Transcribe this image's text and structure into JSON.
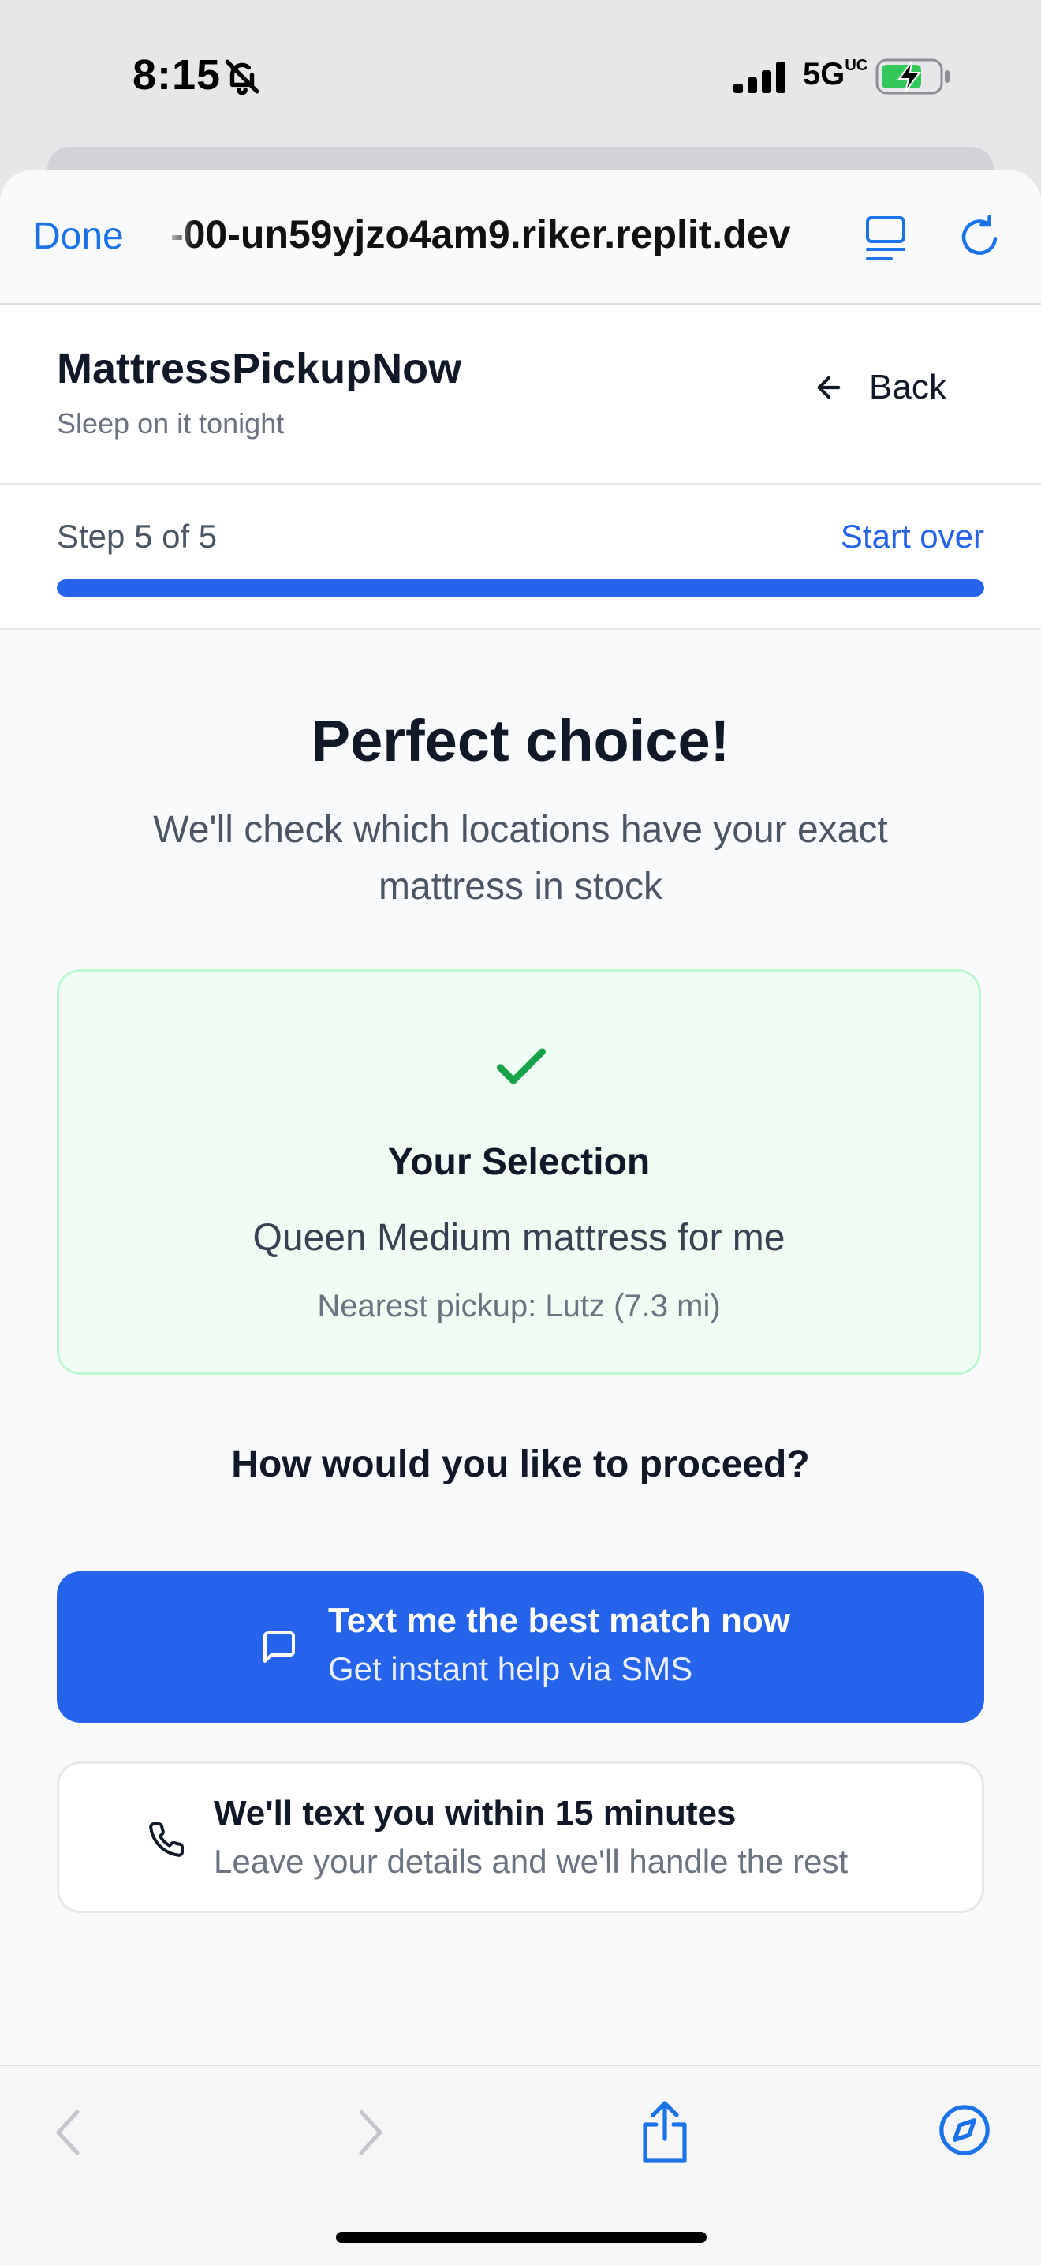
{
  "status_bar": {
    "time": "8:15",
    "network": "5G",
    "network_sup": "UC",
    "icons": [
      "bell-slash-icon",
      "signal-icon",
      "battery-charging-icon"
    ]
  },
  "browser": {
    "done_label": "Done",
    "url": "-00-un59yjzo4am9.riker.replit.dev",
    "icons": [
      "reader-view-icon",
      "reload-icon"
    ]
  },
  "header": {
    "brand": "MattressPickupNow",
    "tagline": "Sleep on it tonight",
    "back_label": "Back"
  },
  "progress": {
    "step_text": "Step 5 of 5",
    "start_over_label": "Start over",
    "fraction": 1.0
  },
  "main": {
    "title": "Perfect choice!",
    "subtitle": "We'll check which locations have your exact mattress in stock",
    "selection_card": {
      "title": "Your Selection",
      "summary": "Queen Medium mattress for me",
      "pickup": "Nearest pickup: Lutz (7.3 mi)"
    },
    "question": "How would you like to proceed?",
    "primary_option": {
      "title": "Text me the best match now",
      "subtitle": "Get instant help via SMS",
      "icon": "message-square-icon"
    },
    "secondary_option": {
      "title": "We'll text you within 15 minutes",
      "subtitle": "Leave your details and we'll handle the rest",
      "icon": "phone-icon"
    }
  },
  "toolbar": {
    "icons": [
      "back-arrow-icon",
      "forward-arrow-icon",
      "share-icon",
      "compass-icon"
    ]
  },
  "colors": {
    "accent": "#2563eb",
    "ios_blue": "#1a73e8",
    "success": "#16a34a",
    "card_bg": "#effcf3",
    "card_border": "#bbf7d0"
  }
}
